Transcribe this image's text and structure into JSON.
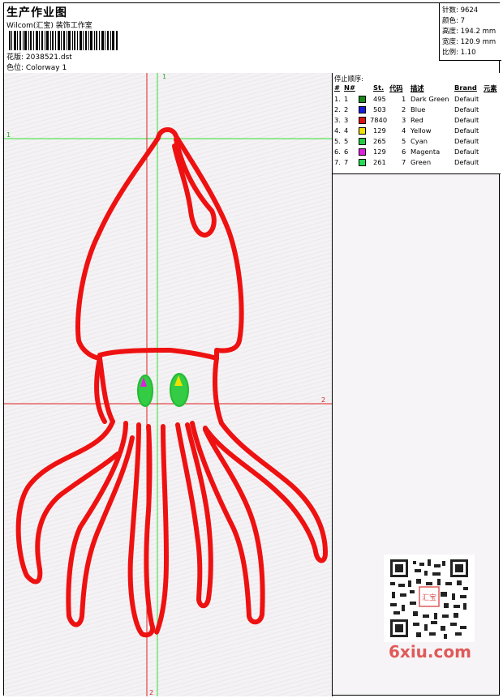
{
  "header": {
    "title": "生产作业图",
    "company": "Wilcom(汇宝) 装饰工作室",
    "design_label": "花版:",
    "design_value": "2038521.dst",
    "colorway_label": "色位:",
    "colorway_value": "Colorway 1"
  },
  "stats": {
    "stitches_label": "针数:",
    "stitches": "9624",
    "colors_label": "颜色:",
    "colors": "7",
    "height_label": "高度:",
    "height": "194.2 mm",
    "width_label": "宽度:",
    "width": "120.9 mm",
    "scale_label": "比例:",
    "scale": "1.10"
  },
  "panel": {
    "caption": "停止顺序:",
    "columns": [
      "#",
      "N#",
      "St.",
      "代码",
      "描述",
      "Brand",
      "元素"
    ],
    "rows": [
      {
        "idx": "1.",
        "n": "1",
        "st": "495",
        "code": "1",
        "desc": "Dark Green",
        "brand": "Default",
        "color": "#1a8a1a"
      },
      {
        "idx": "2.",
        "n": "2",
        "st": "503",
        "code": "2",
        "desc": "Blue",
        "brand": "Default",
        "color": "#1a1ae0"
      },
      {
        "idx": "3.",
        "n": "3",
        "st": "7840",
        "code": "3",
        "desc": "Red",
        "brand": "Default",
        "color": "#e01010"
      },
      {
        "idx": "4.",
        "n": "4",
        "st": "129",
        "code": "4",
        "desc": "Yellow",
        "brand": "Default",
        "color": "#f0e000"
      },
      {
        "idx": "5.",
        "n": "5",
        "st": "265",
        "code": "5",
        "desc": "Cyan",
        "brand": "Default",
        "color": "#22cc44"
      },
      {
        "idx": "6.",
        "n": "6",
        "st": "129",
        "code": "6",
        "desc": "Magenta",
        "brand": "Default",
        "color": "#e020e0"
      },
      {
        "idx": "7.",
        "n": "7",
        "st": "261",
        "code": "7",
        "desc": "Green",
        "brand": "Default",
        "color": "#22dd55"
      }
    ]
  },
  "canvas": {
    "guide1_label": "1",
    "guide2_label": "2",
    "outline_color": "#ee1111",
    "eye_color": "#33cc44"
  },
  "watermark": {
    "text": "6xiu.com",
    "stamp_text": "汇宝"
  }
}
